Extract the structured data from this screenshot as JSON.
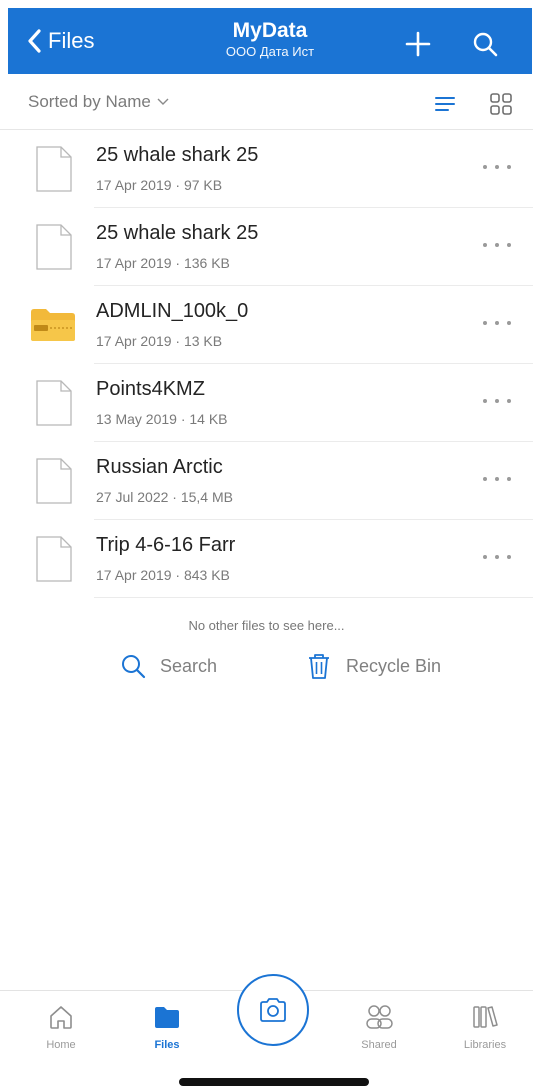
{
  "header": {
    "back_label": "Files",
    "title": "MyData",
    "subtitle": "ООО Дата Ист",
    "add_icon": "plus-icon",
    "search_icon": "search-icon"
  },
  "toolbar": {
    "sort_label": "Sorted by Name",
    "list_view_icon": "list-view-icon",
    "grid_view_icon": "grid-view-icon"
  },
  "files": [
    {
      "name": "25 whale shark 25",
      "meta": "17 Apr 2019 · 97 KB",
      "type": "file"
    },
    {
      "name": "25 whale shark 25",
      "meta": "17 Apr 2019 · 136 KB",
      "type": "file"
    },
    {
      "name": "ADMLIN_100k_0",
      "meta": "17 Apr 2019 · 13 KB",
      "type": "zip"
    },
    {
      "name": "Points4KMZ",
      "meta": "13 May 2019 · 14 KB",
      "type": "file"
    },
    {
      "name": "Russian Arctic",
      "meta": "27 Jul 2022 · 15,4 MB",
      "type": "file"
    },
    {
      "name": "Trip 4-6-16 Farr",
      "meta": "17 Apr 2019 · 843 KB",
      "type": "file"
    }
  ],
  "footer": {
    "no_more_text": "No other files to see here...",
    "search_label": "Search",
    "recycle_label": "Recycle Bin"
  },
  "tabs": [
    {
      "label": "Home",
      "icon": "home-icon"
    },
    {
      "label": "Files",
      "icon": "folder-icon",
      "active": true
    },
    {
      "label": "Shared",
      "icon": "shared-icon"
    },
    {
      "label": "Libraries",
      "icon": "libraries-icon"
    }
  ],
  "camera_icon": "camera-icon",
  "colors": {
    "accent": "#1b74d4",
    "zip_folder": "#f2b93a",
    "secondary_text": "#7a7a7a"
  }
}
